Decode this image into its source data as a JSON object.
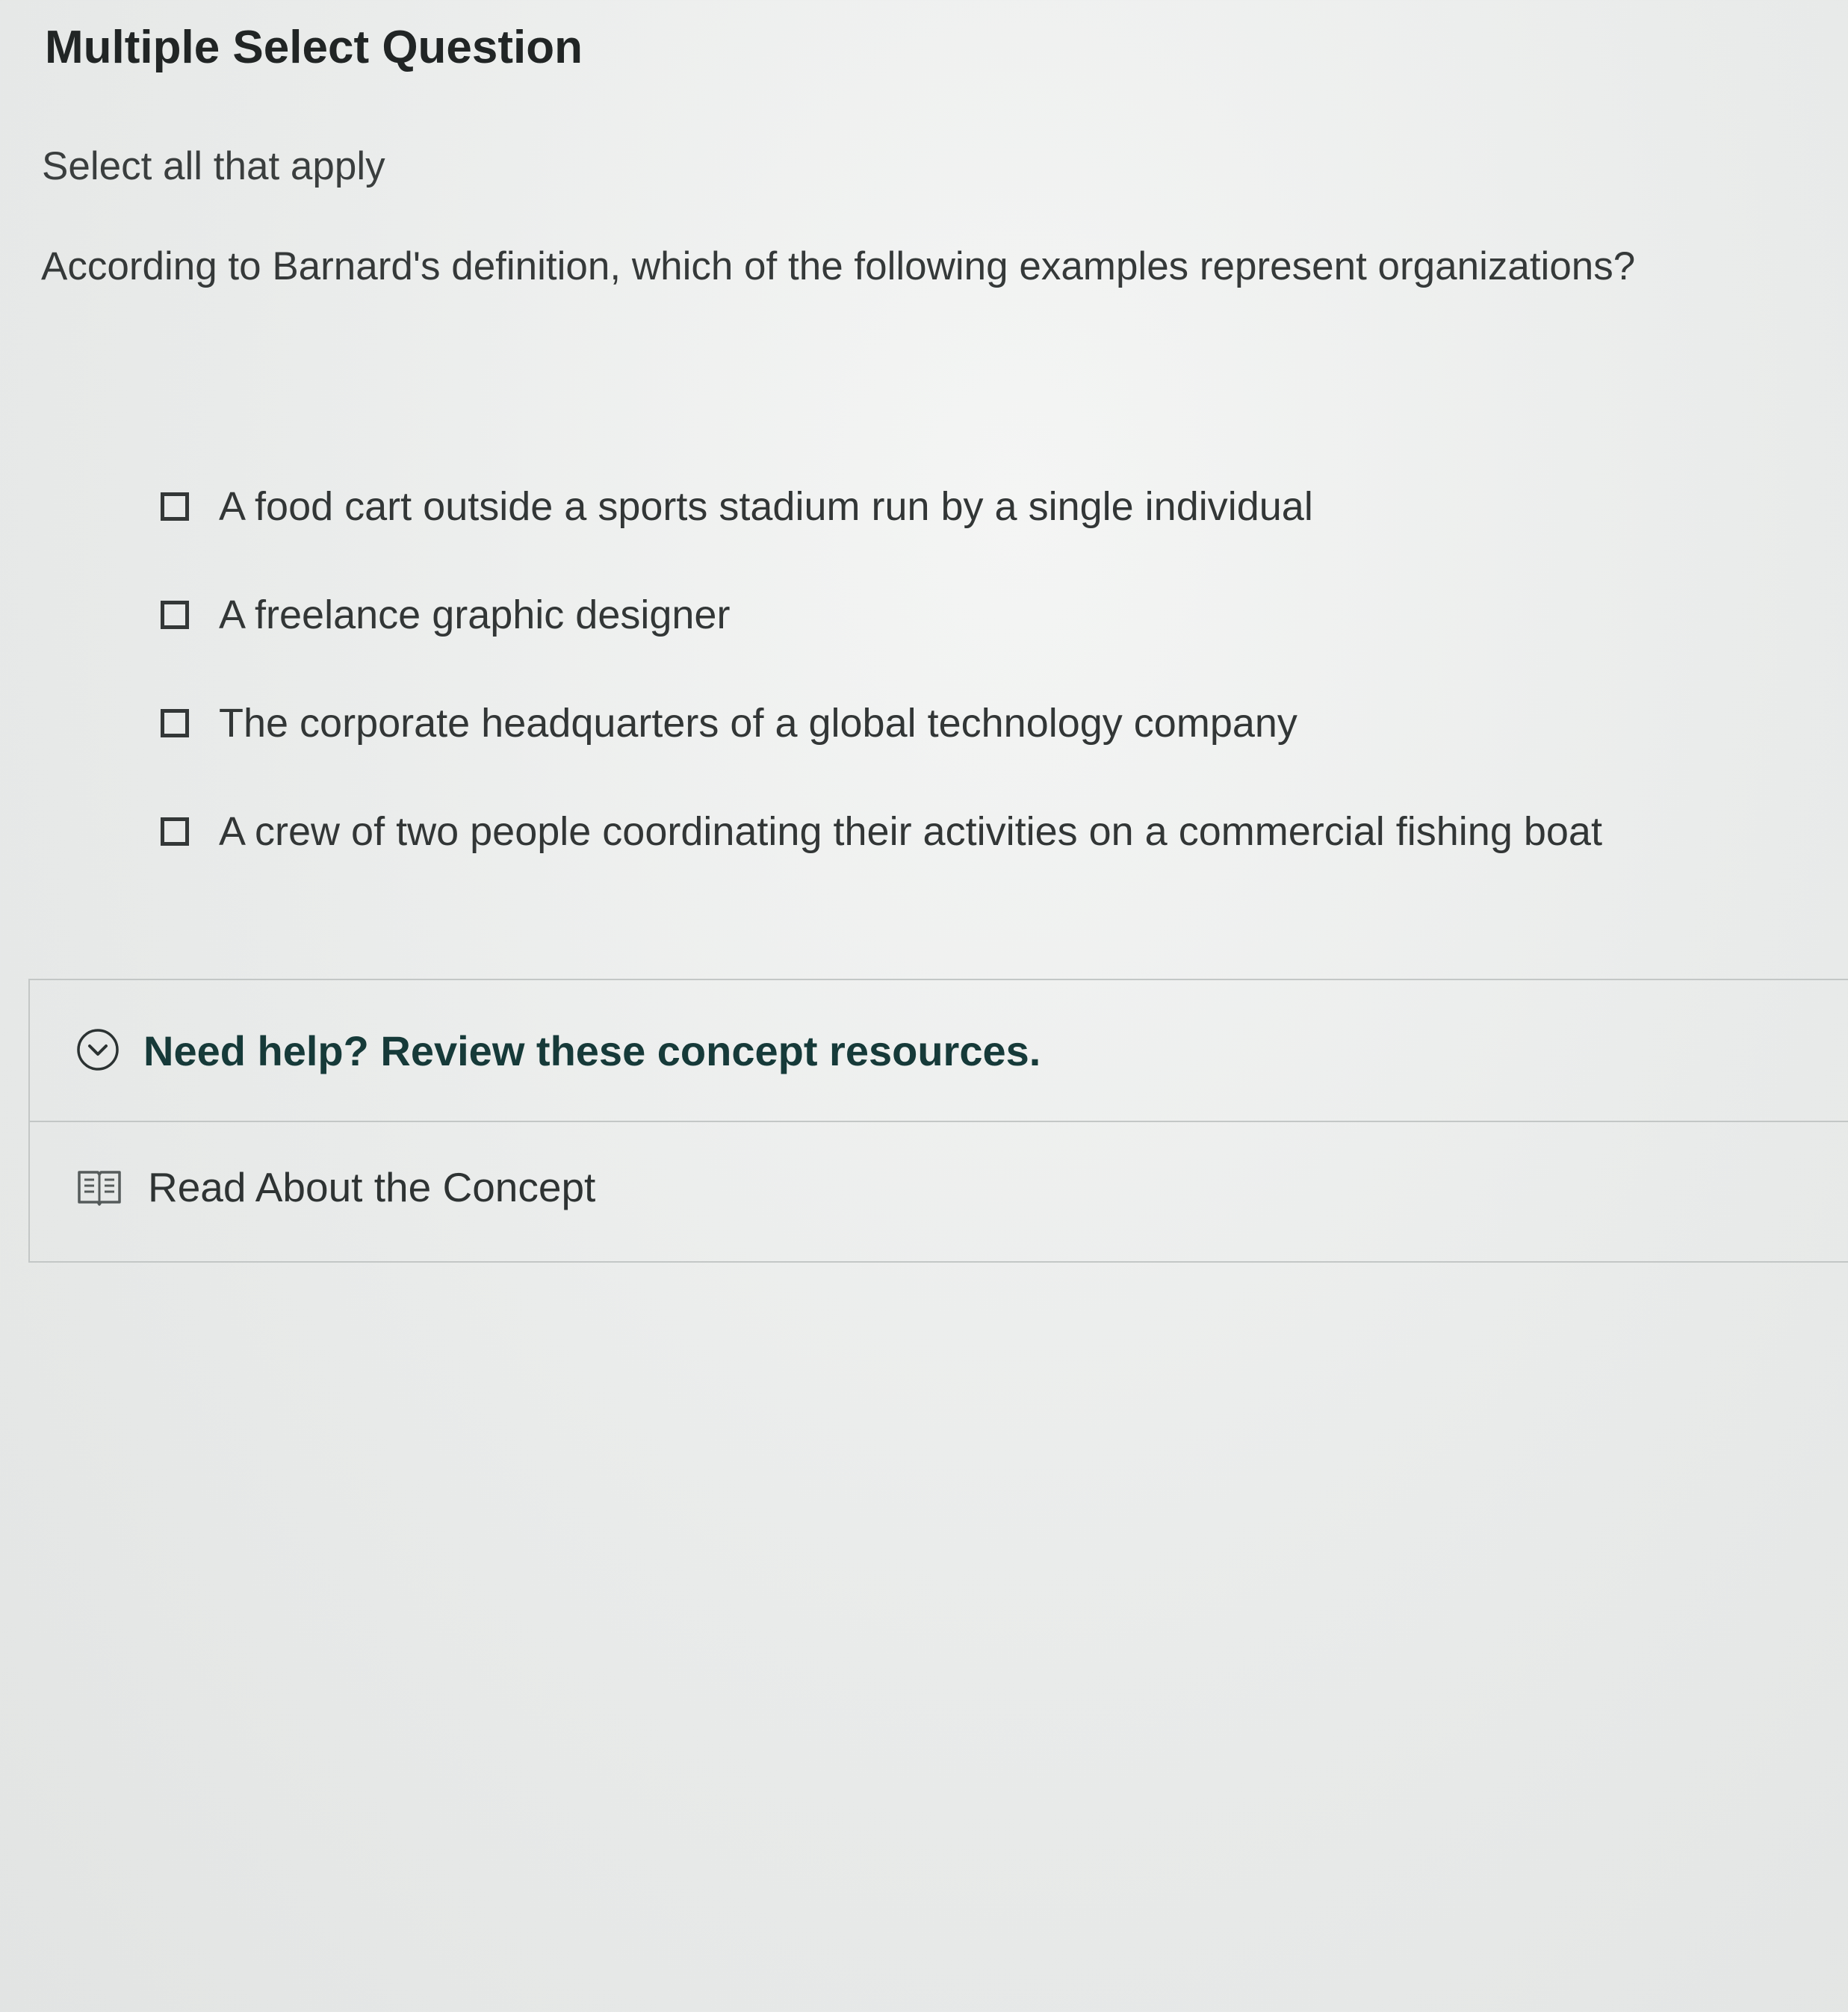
{
  "question": {
    "type_label": "Multiple Select Question",
    "instruction": "Select all that apply",
    "prompt": "According to Barnard's definition, which of the following examples represent organizations?"
  },
  "options": [
    {
      "label": "A food cart outside a sports stadium run by a single individual",
      "checked": false
    },
    {
      "label": "A freelance graphic designer",
      "checked": false
    },
    {
      "label": "The corporate headquarters of a global technology company",
      "checked": false
    },
    {
      "label": "A crew of two people coordinating their activities on a commercial fishing boat",
      "checked": false
    }
  ],
  "help": {
    "title": "Need help? Review these concept resources.",
    "resources": [
      {
        "label": "Read About the Concept",
        "icon": "book-icon"
      }
    ],
    "chevron_icon": "chevron-down-icon"
  },
  "colors": {
    "help_title": "#163a39",
    "border": "#c3c7c6"
  }
}
